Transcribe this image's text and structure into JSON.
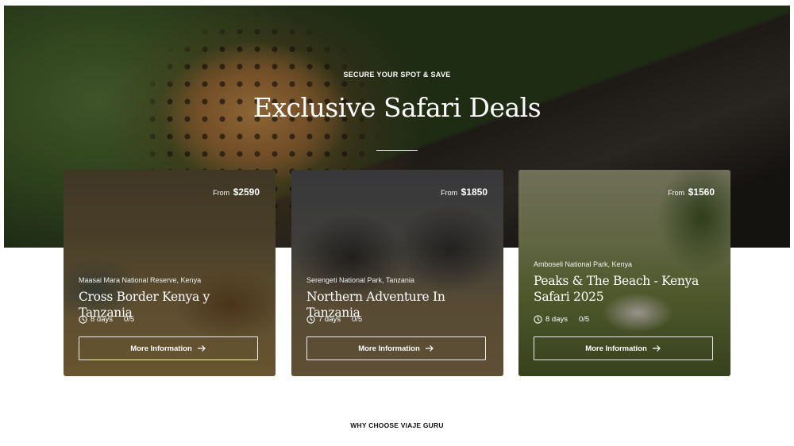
{
  "hero": {
    "eyebrow": "SECURE YOUR SPOT & SAVE",
    "title": "Exclusive Safari Deals"
  },
  "deals": [
    {
      "price_prefix": "From",
      "price": "$2590",
      "location": "Maasai Mara National Reserve, Kenya",
      "title": "Cross Border Kenya y Tanzania",
      "duration": "8 days",
      "rating": "0/5",
      "button_label": "More Information"
    },
    {
      "price_prefix": "From",
      "price": "$1850",
      "location": "Serengeti National Park, Tanzania",
      "title": "Northern Adventure In Tanzania",
      "duration": "7 days",
      "rating": "0/5",
      "button_label": "More Information"
    },
    {
      "price_prefix": "From",
      "price": "$1560",
      "location": "Amboseli National Park, Kenya",
      "title": "Peaks & The Beach - Kenya Safari 2025",
      "duration": "8 days",
      "rating": "0/5",
      "button_label": "More Information"
    }
  ],
  "next_section": {
    "heading": "WHY CHOOSE VIAJE GURU"
  },
  "icons": {
    "duration": "clock-icon",
    "button": "arrow-right-icon"
  }
}
